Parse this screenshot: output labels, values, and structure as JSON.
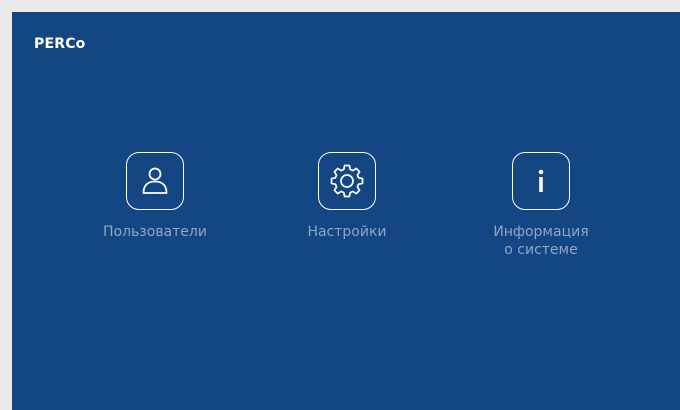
{
  "header": {
    "logo_text": "PERCo"
  },
  "menu": {
    "users": {
      "label": "Пользователи",
      "icon": "user-icon"
    },
    "settings": {
      "label": "Настройки",
      "icon": "gear-icon"
    },
    "info": {
      "label_line1": "Информация",
      "label_line2": "о системе",
      "icon": "info-icon"
    }
  },
  "colors": {
    "background": "#134683",
    "label": "#8fa6c6",
    "icon": "#ffffff"
  }
}
